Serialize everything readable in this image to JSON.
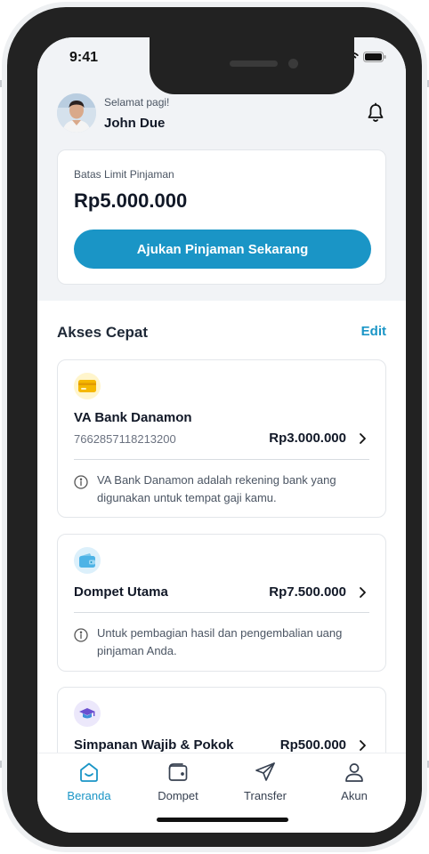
{
  "status_bar": {
    "time": "9:41"
  },
  "header": {
    "greeting": "Selamat pagi!",
    "user_name": "John Due"
  },
  "loan_card": {
    "label": "Batas Limit Pinjaman",
    "amount": "Rp5.000.000",
    "button_label": "Ajukan Pinjaman Sekarang"
  },
  "quick_access": {
    "title": "Akses Cepat",
    "edit_label": "Edit",
    "accounts": [
      {
        "name": "VA Bank Danamon",
        "number": "7662857118213200",
        "balance": "Rp3.000.000",
        "info": "VA Bank Danamon adalah rekening bank yang digunakan untuk tempat gaji kamu.",
        "icon": "card-icon"
      },
      {
        "name": "Dompet Utama",
        "balance": "Rp7.500.000",
        "info": "Untuk pembagian hasil dan pengembalian uang pinjaman Anda.",
        "icon": "wallet-icon"
      },
      {
        "name": "Simpanan Wajib & Pokok",
        "balance": "Rp500.000",
        "icon": "savings-icon"
      }
    ]
  },
  "bottom_nav": {
    "items": [
      {
        "label": "Beranda",
        "icon": "home-icon",
        "active": true
      },
      {
        "label": "Dompet",
        "icon": "wallet-icon",
        "active": false
      },
      {
        "label": "Transfer",
        "icon": "send-icon",
        "active": false
      },
      {
        "label": "Akun",
        "icon": "user-icon",
        "active": false
      }
    ]
  },
  "colors": {
    "accent": "#1a95c6",
    "header_bg": "#f1f3f6",
    "phone_frame": "#222222"
  }
}
